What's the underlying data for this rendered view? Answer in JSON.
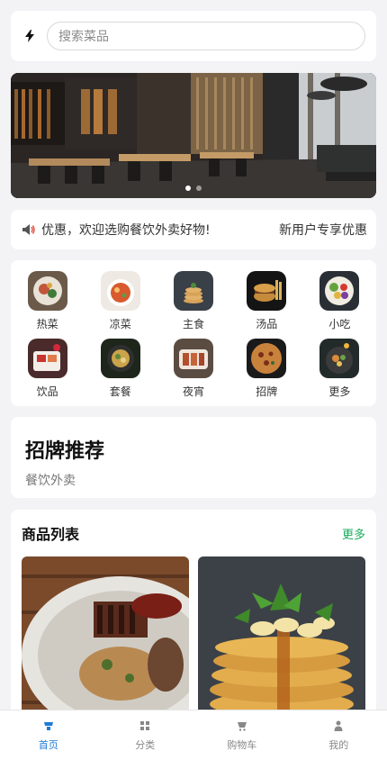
{
  "search": {
    "icon": "bolt-icon",
    "placeholder": "搜索菜品"
  },
  "banner": {
    "image": "restaurant-interior",
    "dots": 2,
    "active_dot": 0
  },
  "notice": {
    "icon": "speaker-icon",
    "scroll_text": "享优惠，欢迎选购餐饮外卖好物!",
    "tag": "新用户专享优惠"
  },
  "categories": [
    {
      "label": "热菜",
      "icon": "hot-dish-icon"
    },
    {
      "label": "凉菜",
      "icon": "cold-dish-icon"
    },
    {
      "label": "主食",
      "icon": "staple-food-icon"
    },
    {
      "label": "汤品",
      "icon": "soup-icon"
    },
    {
      "label": "小吃",
      "icon": "snack-icon"
    },
    {
      "label": "饮品",
      "icon": "drink-icon"
    },
    {
      "label": "套餐",
      "icon": "set-meal-icon"
    },
    {
      "label": "夜宵",
      "icon": "late-night-snack-icon"
    },
    {
      "label": "招牌",
      "icon": "signature-icon"
    },
    {
      "label": "更多",
      "icon": "more-icon"
    }
  ],
  "featured": {
    "title": "招牌推荐",
    "subtitle": "餐饮外卖"
  },
  "products": {
    "title": "商品列表",
    "more": "更多",
    "items": [
      {
        "image": "steak-plate"
      },
      {
        "image": "pancake-stack"
      }
    ]
  },
  "tabbar": {
    "items": [
      {
        "label": "首页",
        "icon": "home-icon",
        "active": true
      },
      {
        "label": "分类",
        "icon": "grid-icon",
        "active": false
      },
      {
        "label": "购物车",
        "icon": "cart-icon",
        "active": false
      },
      {
        "label": "我的",
        "icon": "user-icon",
        "active": false
      }
    ]
  },
  "colors": {
    "accent": "#1e7bd6",
    "more_link": "#1aad5b",
    "background": "#f3f3f5"
  }
}
